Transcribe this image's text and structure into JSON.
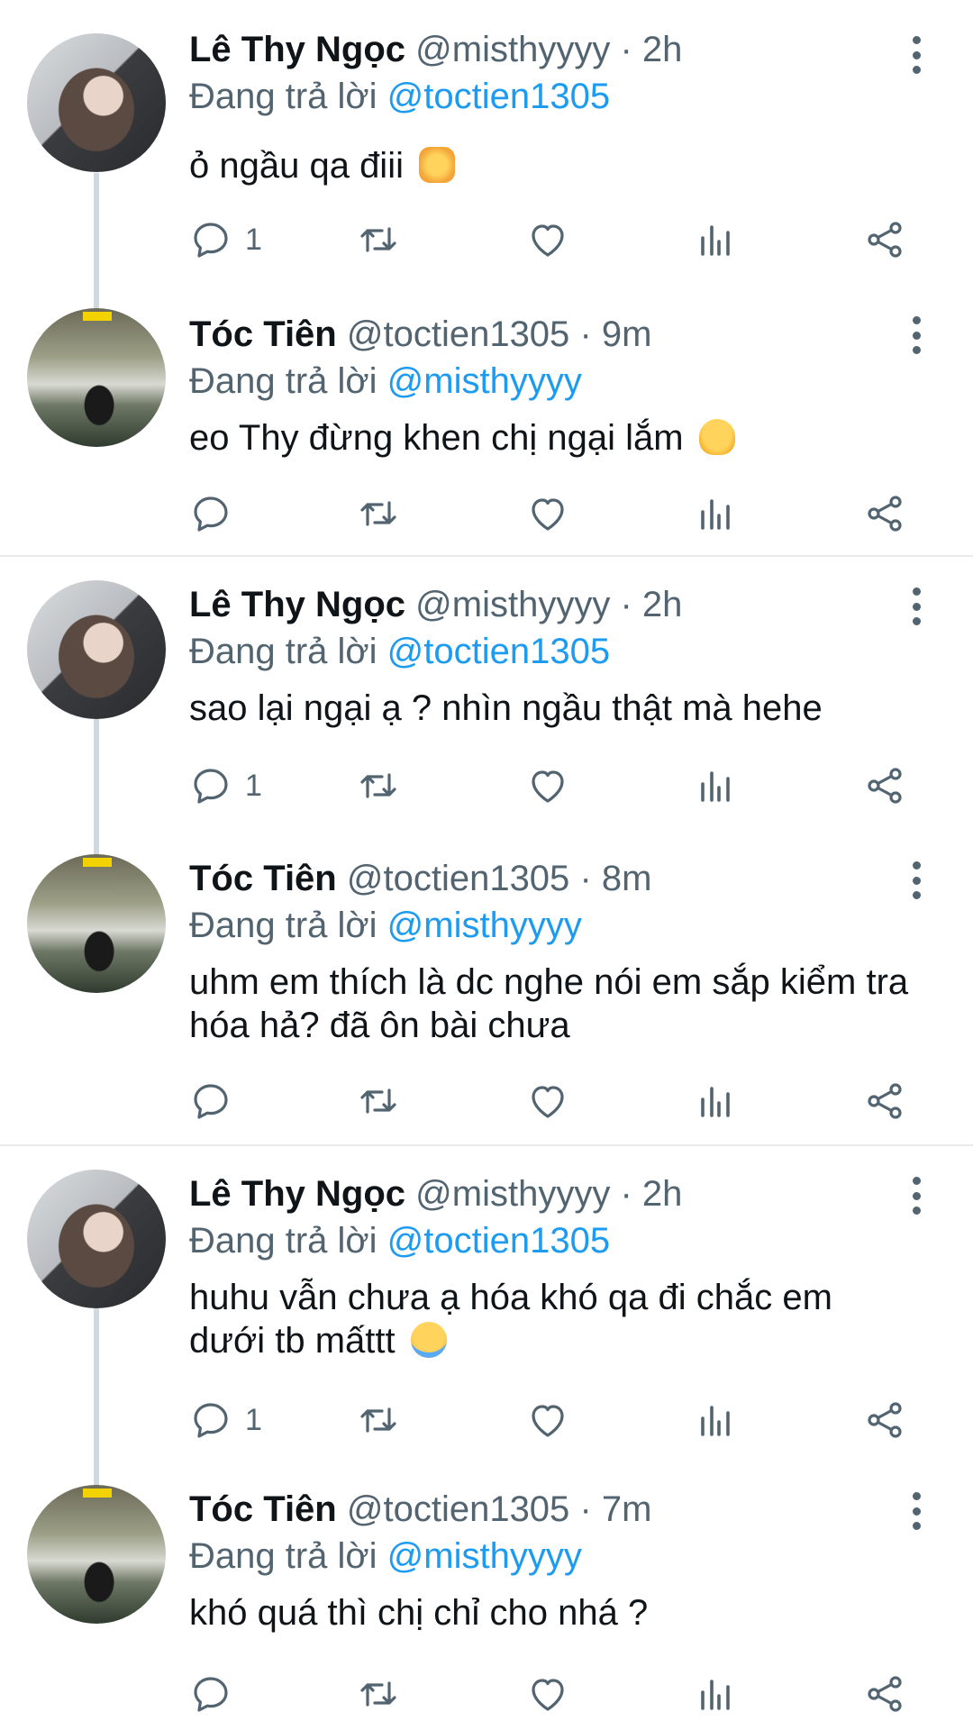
{
  "tweets": [
    {
      "name": "Lê Thy Ngọc",
      "handle": "@misthyyyy",
      "sep": "·",
      "time": "2h",
      "reply_prefix": "Đang trả lời",
      "reply_to": "@toctien1305",
      "text": "ỏ ngầu qa điii",
      "emoji": "heart-hands-emoji",
      "reply_count": "1"
    },
    {
      "name": "Tóc Tiên",
      "handle": "@toctien1305",
      "sep": "·",
      "time": "9m",
      "reply_prefix": "Đang trả lời",
      "reply_to": "@misthyyyy",
      "text": "eo Thy đừng khen chị ngại lắm",
      "emoji": "melting-face-emoji",
      "reply_count": ""
    },
    {
      "name": "Lê Thy Ngọc",
      "handle": "@misthyyyy",
      "sep": "·",
      "time": "2h",
      "reply_prefix": "Đang trả lời",
      "reply_to": "@toctien1305",
      "text": "sao lại ngại ạ ? nhìn ngầu thật mà hehe",
      "emoji": "",
      "reply_count": "1"
    },
    {
      "name": "Tóc Tiên",
      "handle": "@toctien1305",
      "sep": "·",
      "time": "8m",
      "reply_prefix": "Đang trả lời",
      "reply_to": "@misthyyyy",
      "text": "uhm em thích là dc nghe nói em sắp kiểm tra hóa hả? đã ôn bài chưa",
      "emoji": "",
      "reply_count": ""
    },
    {
      "name": "Lê Thy Ngọc",
      "handle": "@misthyyyy",
      "sep": "·",
      "time": "2h",
      "reply_prefix": "Đang trả lời",
      "reply_to": "@toctien1305",
      "text": "huhu vẫn chưa ạ hóa khó qa đi chắc em dưới tb mấttt",
      "emoji": "crying-face-emoji",
      "reply_count": "1"
    },
    {
      "name": "Tóc Tiên",
      "handle": "@toctien1305",
      "sep": "·",
      "time": "7m",
      "reply_prefix": "Đang trả lời",
      "reply_to": "@misthyyyy",
      "text": "khó quá thì chị chỉ cho nhá ?",
      "emoji": "",
      "reply_count": ""
    }
  ],
  "icons": {
    "reply": "reply-icon",
    "retweet": "retweet-icon",
    "like": "like-icon",
    "views": "views-icon",
    "share": "share-icon",
    "more": "more-options-icon"
  },
  "colors": {
    "mention": "#1d9bf0",
    "secondary": "#536471",
    "thread_line": "#cfd9de"
  }
}
